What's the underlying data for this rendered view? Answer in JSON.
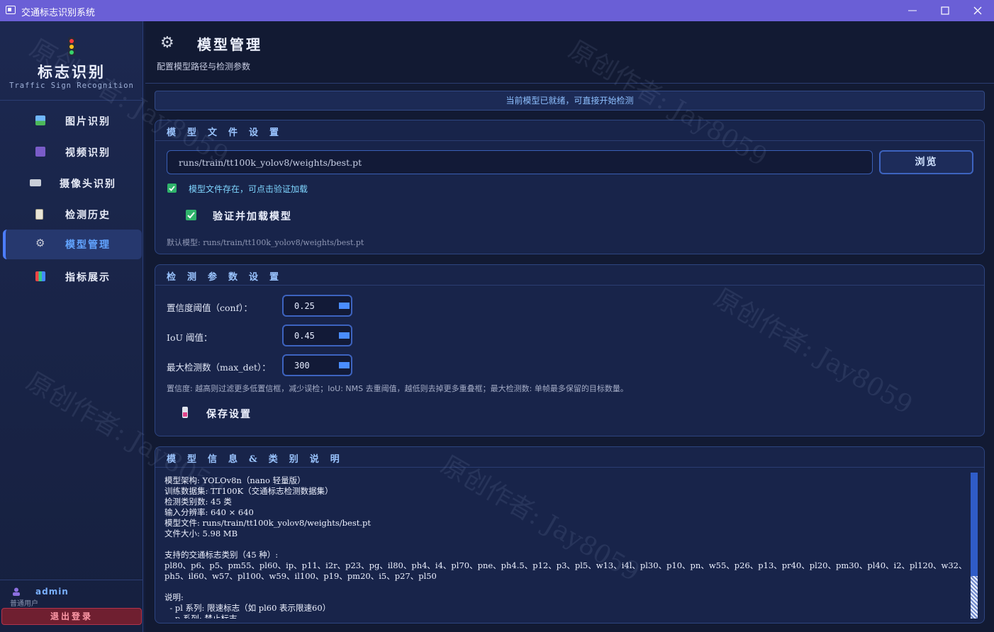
{
  "window": {
    "title": "交通标志识别系统"
  },
  "brand": {
    "title": "标志识别",
    "subtitle": "Traffic Sign Recognition"
  },
  "sidebar": {
    "items": [
      {
        "label": "图片识别",
        "icon": "image-icon"
      },
      {
        "label": "视频识别",
        "icon": "video-icon"
      },
      {
        "label": "摄像头识别",
        "icon": "camera-icon"
      },
      {
        "label": "检测历史",
        "icon": "history-icon"
      },
      {
        "label": "模型管理",
        "icon": "gear-icon",
        "active": true
      },
      {
        "label": "指标展示",
        "icon": "chart-icon"
      }
    ],
    "user": {
      "name": "admin",
      "role": "普通用户"
    },
    "logout_label": "退出登录"
  },
  "header": {
    "title": "模型管理",
    "subtitle": "配置模型路径与检测参数"
  },
  "status_text": "当前模型已就绪，可直接开始检测",
  "model_file": {
    "section_title": "模型文件设置",
    "path_value": "runs/train/tt100k_yolov8/weights/best.pt",
    "browse_label": "浏览",
    "exists_note": "模型文件存在，可点击验证加载",
    "verify_label": "验证并加载模型",
    "default_note": "默认模型: runs/train/tt100k_yolov8/weights/best.pt"
  },
  "params": {
    "section_title": "检测参数设置",
    "conf_label": "置信度阈值（conf）：",
    "conf_value": "0.25",
    "iou_label": "IoU 阈值：",
    "iou_value": "0.45",
    "maxdet_label": "最大检测数（max_det）：",
    "maxdet_value": "300",
    "hint": "置信度: 越高则过滤更多低置信框，减少误检；IoU: NMS 去重阈值，越低则去掉更多重叠框；最大检测数: 单帧最多保留的目标数量。",
    "save_label": "保存设置"
  },
  "info": {
    "section_title": "模型信息&类别说明",
    "text": "模型架构: YOLOv8n（nano 轻量版）\n训练数据集: TT100K（交通标志检测数据集）\n检测类别数: 45 类\n输入分辨率: 640 × 640\n模型文件: runs/train/tt100k_yolov8/weights/best.pt\n文件大小: 5.98 MB\n\n支持的交通标志类别（45 种）:\npl80、p6、p5、pm55、pl60、ip、p11、i2r、p23、pg、il80、ph4、i4、pl70、pne、ph4.5、p12、p3、pl5、w13、i4l、pl30、p10、pn、w55、p26、p13、pr40、pl20、pm30、pl40、i2、pl120、w32、ph5、il60、w57、pl100、w59、il100、p19、pm20、i5、p27、pl50\n\n说明:\n  - pl 系列: 限速标志（如 pl60 表示限速60）\n  - p 系列: 禁止标志"
  },
  "watermark": "原创作者: Jay8059",
  "colors": {
    "titlebar": "#6a5fd6",
    "accent": "#4c7dff",
    "success": "#2fb36b",
    "danger": "#b2344c"
  }
}
